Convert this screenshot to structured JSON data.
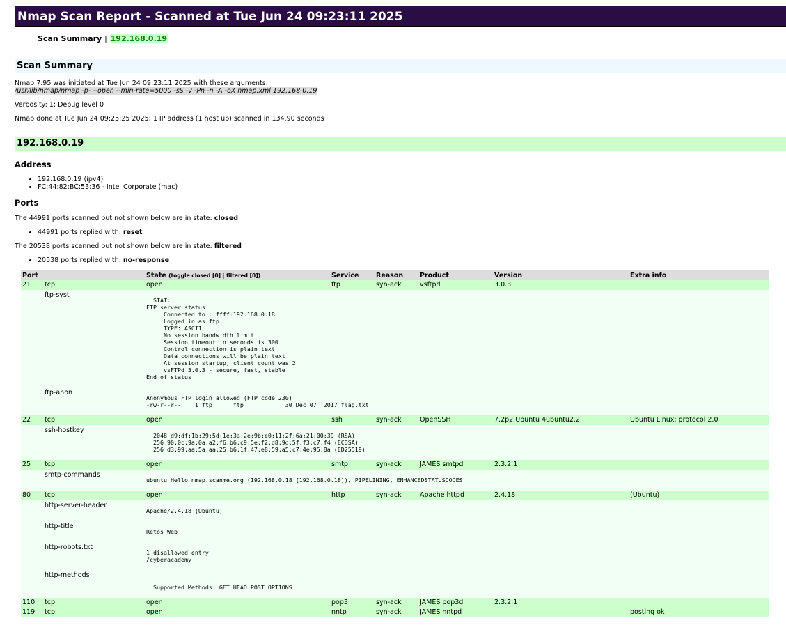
{
  "header": {
    "title": "Nmap Scan Report - Scanned at Tue Jun 24 09:23:11 2025"
  },
  "nav": {
    "summary_label": "Scan Summary",
    "separator": "|",
    "host_link": "192.168.0.19"
  },
  "summary": {
    "heading": "Scan Summary",
    "line1": "Nmap 7.95 was initiated at Tue Jun 24 09:23:11 2025 with these arguments:",
    "command": "/usr/lib/nmap/nmap -p- --open --min-rate=5000 -sS -v -Pn -n -A -oX nmap.xml 192.168.0.19",
    "verbosity": "Verbosity: 1; Debug level 0",
    "done": "Nmap done at Tue Jun 24 09:25:25 2025; 1 IP address (1 host up) scanned in 134.90 seconds"
  },
  "host": {
    "heading": "192.168.0.19",
    "address_heading": "Address",
    "addresses": [
      "192.168.0.19 (ipv4)",
      "FC:44:82:BC:53:36 - Intel Corporate (mac)"
    ],
    "ports_heading": "Ports",
    "extra1_text": "The 44991 ports scanned but not shown below are in state: ",
    "extra1_state": "closed",
    "extra1_reason_text": "44991 ports replied with: ",
    "extra1_reason": "reset",
    "extra2_text": "The 20538 ports scanned but not shown below are in state: ",
    "extra2_state": "filtered",
    "extra2_reason_text": "20538 ports replied with: ",
    "extra2_reason": "no-response"
  },
  "table": {
    "headers": {
      "port": "Port",
      "state": "State",
      "toggle_prefix": "(toggle ",
      "toggle_closed": "closed [0]",
      "toggle_sep": " | ",
      "toggle_filtered": "filtered [0]",
      "toggle_suffix": ")",
      "service": "Service",
      "reason": "Reason",
      "product": "Product",
      "version": "Version",
      "extra": "Extra info"
    },
    "ports": [
      {
        "port": "21",
        "proto": "tcp",
        "state": "open",
        "service": "ftp",
        "reason": "syn-ack",
        "product": "vsftpd",
        "version": "3.0.3",
        "extra": "",
        "scripts": [
          {
            "name": "ftp-syst",
            "output": "\n  STAT: \nFTP server status:\n     Connected to ::ffff:192.168.0.18\n     Logged in as ftp\n     TYPE: ASCII\n     No session bandwidth limit\n     Session timeout in seconds is 300\n     Control connection is plain text\n     Data connections will be plain text\n     At session startup, client count was 2\n     vsFTPd 3.0.3 - secure, fast, stable\nEnd of status\n "
          },
          {
            "name": "ftp-anon",
            "output": "\nAnonymous FTP login allowed (FTP code 230)\n-rw-r--r--    1 ftp      ftp            30 Dec 07  2017 flag.txt\n "
          }
        ]
      },
      {
        "port": "22",
        "proto": "tcp",
        "state": "open",
        "service": "ssh",
        "reason": "syn-ack",
        "product": "OpenSSH",
        "version": "7.2p2 Ubuntu 4ubuntu2.2",
        "extra": "Ubuntu Linux; protocol 2.0",
        "scripts": [
          {
            "name": "ssh-hostkey",
            "output": "\n  2048 d9:df:1b:29:5d:1e:3a:2e:9b:e0:11:2f:6a:21:00:39 (RSA)\n  256 90:0c:9a:0a:a2:f6:b6:c9:5e:f2:d8:9d:5f:f3:c7:f4 (ECDSA)\n  256 d3:99:aa:5a:aa:25:b6:1f:47:e8:59:a5:c7:4e:95:8a (ED25519)\n "
          }
        ]
      },
      {
        "port": "25",
        "proto": "tcp",
        "state": "open",
        "service": "smtp",
        "reason": "syn-ack",
        "product": "JAMES smtpd",
        "version": "2.3.2.1",
        "extra": "",
        "scripts": [
          {
            "name": "smtp-commands",
            "output": "\nubuntu Hello nmap.scanme.org (192.168.0.18 [192.168.0.18]), PIPELINING, ENHANCEDSTATUSCODES\n "
          }
        ]
      },
      {
        "port": "80",
        "proto": "tcp",
        "state": "open",
        "service": "http",
        "reason": "syn-ack",
        "product": "Apache httpd",
        "version": "2.4.18",
        "extra": "(Ubuntu)",
        "scripts": [
          {
            "name": "http-server-header",
            "output": "\nApache/2.4.18 (Ubuntu)\n "
          },
          {
            "name": "http-title",
            "output": "\nRetos Web\n "
          },
          {
            "name": "http-robots.txt",
            "output": "\n1 disallowed entry \n/cyberacademy\n "
          },
          {
            "name": "http-methods",
            "output": "\n\n  Supported Methods: GET HEAD POST OPTIONS\n "
          }
        ]
      },
      {
        "port": "110",
        "proto": "tcp",
        "state": "open",
        "service": "pop3",
        "reason": "syn-ack",
        "product": "JAMES pop3d",
        "version": "2.3.2.1",
        "extra": "",
        "scripts": []
      },
      {
        "port": "119",
        "proto": "tcp",
        "state": "open",
        "service": "nntp",
        "reason": "syn-ack",
        "product": "JAMES nntpd",
        "version": "",
        "extra": "posting ok",
        "scripts": []
      }
    ]
  }
}
